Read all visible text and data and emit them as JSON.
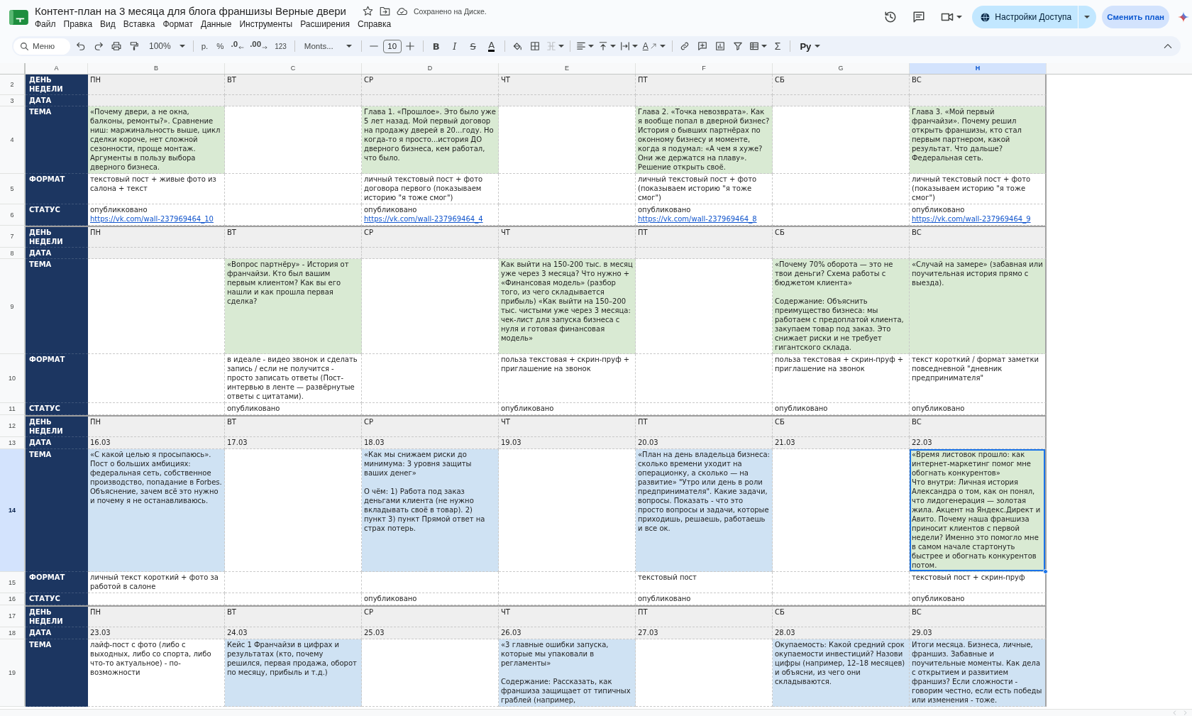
{
  "document": {
    "title": "Контент-план на 3 месяца для блога франшизы Верные двери",
    "save_status": "Сохранено на Диске."
  },
  "menu": [
    "Файл",
    "Правка",
    "Вид",
    "Вставка",
    "Формат",
    "Данные",
    "Инструменты",
    "Расширения",
    "Справка"
  ],
  "actions": {
    "share": "Настройки Доступа",
    "change_plan": "Сменить план"
  },
  "toolbar": {
    "search_placeholder": "Меню",
    "zoom": "100%",
    "currency": "р.",
    "percent": "%",
    "decrease_decimals": ".0",
    "increase_decimals": ".00",
    "number_format": "123",
    "font": "Monts...",
    "font_size": "10",
    "bold": "B",
    "italic": "I",
    "strikethrough": "S",
    "text_color": "A",
    "merge_disabled": true,
    "text_rotation": "A",
    "functions": "Σ",
    "input_tools": "Ру"
  },
  "columns": [
    {
      "label": "A",
      "selected": false
    },
    {
      "label": "B",
      "selected": false
    },
    {
      "label": "C",
      "selected": false
    },
    {
      "label": "D",
      "selected": false
    },
    {
      "label": "E",
      "selected": false
    },
    {
      "label": "F",
      "selected": false
    },
    {
      "label": "G",
      "selected": false
    },
    {
      "label": "H",
      "selected": true
    }
  ],
  "weeks": [
    {
      "rows": [
        {
          "number": "2",
          "selected": false,
          "kind": "day",
          "label": "ДЕНЬ НЕДЕЛИ",
          "cells": [
            {
              "text": "ПН"
            },
            {
              "text": "ВТ"
            },
            {
              "text": "СР"
            },
            {
              "text": "ЧТ"
            },
            {
              "text": "ПТ"
            },
            {
              "text": "СБ"
            },
            {
              "text": "ВС"
            }
          ]
        },
        {
          "number": "3",
          "selected": false,
          "kind": "date",
          "label": "ДАТА",
          "cells": [
            {},
            {},
            {},
            {},
            {},
            {},
            {}
          ]
        },
        {
          "number": "4",
          "selected": false,
          "kind": "topic",
          "label": "ТЕМА",
          "cells": [
            {
              "text": "«Почему двери, а не окна, балконы, ремонты?». Сравнение ниш: маржинальность выше, цикл сделки короче, нет сложной сезонности, проще монтаж. Аргументы в пользу выбора дверного бизнеса.",
              "color": "#d9ead3"
            },
            {},
            {
              "text": "Глава 1. «Прошлое». Это было уже 5 лет назад. Мой первый договор на продажу дверей в 20...году. Но когда-то я просто...история ДО дверного бизнеса, кем работал, что было.",
              "color": "#d9ead3"
            },
            {},
            {
              "text": "Глава 2. «Точка невозврата». Как я вообще попал в дверной бизнес? История о бывших партнёрах по оконному бизнесу и моменте, когда я подумал: «А чем я хуже? Они же держатся на плаву». Решение открыть своё.",
              "color": "#d9ead3"
            },
            {},
            {
              "text": "Глава 3. «Мой первый франчайзи». Почему решил открыть франшизы, кто стал первым партнером, какой результат. Что дальше? Федеральная сеть.",
              "color": "#d9ead3"
            }
          ]
        },
        {
          "number": "5",
          "selected": false,
          "kind": "format",
          "label": "ФОРМАТ",
          "cells": [
            {
              "text": "текстовый пост + живые фото из салона + текст"
            },
            {},
            {
              "text": "личный текстовый пост + фото договора первого (показываем историю \"я тоже смог\")"
            },
            {},
            {
              "text": "личный текстовый пост + фото (показываем историю \"я тоже смог\")"
            },
            {},
            {
              "text": "личный текстовый пост + фото (показываем историю \"я тоже смог\")"
            }
          ]
        },
        {
          "number": "6",
          "selected": false,
          "kind": "status",
          "label": "СТАТУС",
          "cells": [
            {
              "text": "опубликковано",
              "link": "https://vk.com/wall-237969464_10"
            },
            {},
            {
              "text": "опубликовано",
              "link": "https://vk.com/wall-237969464_4"
            },
            {},
            {
              "text": "опубликовано",
              "link": "https://vk.com/wall-237969464_8"
            },
            {},
            {
              "text": "опубликовано",
              "link": "https://vk.com/wall-237969464_9"
            }
          ]
        }
      ]
    },
    {
      "rows": [
        {
          "number": "7",
          "selected": false,
          "kind": "day",
          "label": "ДЕНЬ НЕДЕЛИ",
          "cells": [
            {
              "text": "ПН"
            },
            {
              "text": "ВТ"
            },
            {
              "text": "СР"
            },
            {
              "text": "ЧТ"
            },
            {
              "text": "ПТ"
            },
            {
              "text": "СБ"
            },
            {
              "text": "ВС"
            }
          ]
        },
        {
          "number": "8",
          "selected": false,
          "kind": "date",
          "label": "ДАТА",
          "cells": [
            {},
            {},
            {},
            {},
            {},
            {},
            {}
          ]
        },
        {
          "number": "9",
          "selected": false,
          "kind": "topic",
          "label": "ТЕМА",
          "cells": [
            {},
            {
              "text": "«Вопрос партнёру» - История от франчайзи. Кто был вашим первым клиентом? Как вы его нашли и как прошла первая сделка?",
              "color": "#d9ead3"
            },
            {},
            {
              "text": "Как выйти на 150-200 тыс. в месяц уже через 3 месяца? Что нужно + «Финансовая модель» (разбор того, из чего складывается прибыль) «Как выйти на 150–200 тыс. чистыми уже через 3 месяца: чек-лист для запуска бизнеса с нуля и готовая финансовая модель»",
              "color": "#d9ead3"
            },
            {},
            {
              "text": "«Почему 70% оборота — это не твои деньги? Схема работы с бюджетом клиента»\n\nСодержание: Объяснить преимущество бизнеса: мы работаем с предоплатой клиента, закупаем товар под заказ. Это снижает риски и не требует гигантского склада.",
              "color": "#d9ead3"
            },
            {
              "text": "«Случай на замере» (забавная или поучительная история прямо с выезда).",
              "color": "#d9ead3"
            }
          ]
        },
        {
          "number": "10",
          "selected": false,
          "kind": "format",
          "label": "ФОРМАТ",
          "cells": [
            {},
            {
              "text": "в идеале - видео звонок и сделать запись / если не получится - просто записать ответы (Пост-интервью в ленте — развёрнутые ответы с цитатами)."
            },
            {},
            {
              "text": "польза текстовая + скрин-пруф + приглашение на звонок"
            },
            {},
            {
              "text": "польза текстовая + скрин-пруф + приглашение на звонок"
            },
            {
              "text": "текст короткий / формат заметки повседневной \"дневник предпринимателя\""
            }
          ]
        },
        {
          "number": "11",
          "selected": false,
          "kind": "status",
          "label": "СТАТУС",
          "cells": [
            {},
            {
              "text": "опубликовано"
            },
            {},
            {
              "text": "опубликовано"
            },
            {},
            {
              "text": "опубликовано"
            },
            {
              "text": "опубликовано"
            }
          ]
        }
      ]
    },
    {
      "rows": [
        {
          "number": "12",
          "selected": false,
          "kind": "day",
          "label": "ДЕНЬ НЕДЕЛИ",
          "cells": [
            {
              "text": "ПН"
            },
            {
              "text": "ВТ"
            },
            {
              "text": "СР"
            },
            {
              "text": "ЧТ"
            },
            {
              "text": "ПТ"
            },
            {
              "text": "СБ"
            },
            {
              "text": "ВС"
            }
          ]
        },
        {
          "number": "13",
          "selected": false,
          "kind": "date",
          "label": "ДАТА",
          "cells": [
            {
              "text": "16.03"
            },
            {
              "text": "17.03"
            },
            {
              "text": "18.03"
            },
            {
              "text": "19.03"
            },
            {
              "text": "20.03"
            },
            {
              "text": "21.03"
            },
            {
              "text": "22.03"
            }
          ]
        },
        {
          "number": "14",
          "selected": true,
          "kind": "topic",
          "label": "ТЕМА",
          "cells": [
            {
              "text": "«С какой целью я просыпаюсь». Пост о больших амбициях: федеральная сеть, собственное производство, попадание в Forbes. Объяснение, зачем всё это нужно и почему я не останавливаюсь.",
              "color": "#cfe2f3"
            },
            {},
            {
              "text": "«Как мы снижаем риски до минимума: 3 уровня защиты ваших денег»\n\nО чём: 1) Работа под заказ деньгами клиента (не нужно вкладывать своё в товар). 2) пункт 3) пункт Прямой ответ на страх потерь.",
              "color": "#cfe2f3"
            },
            {},
            {
              "text": "«План на день владельца бизнеса: сколько времени уходит на операционку, а сколько — на развитие» \"Утро или день в роли предпринимателя\". Какие задачи, вопросы. Показать - что это просто вопросы и задачи, которые приходишь, решаешь, работаешь и все ок.",
              "color": "#cfe2f3"
            },
            {},
            {
              "text": "«Время листовок прошло: как интернет-маркетинг помог мне обогнать конкурентов»\nЧто внутри: Личная история Александра о том, как он понял, что лидогенерация — золотая жила. Акцент на Яндекс.Директ и Авито. Почему наша франшиза приносит клиентов с первой недели? Именно это помогло мне в самом начале стартонуть быстрее и обогнать конкурентов потом.",
              "color": "#d9ead3"
            }
          ]
        },
        {
          "number": "15",
          "selected": false,
          "kind": "format",
          "label": "ФОРМАТ",
          "cells": [
            {
              "text": "личный текст короткий + фото за работой в салоне"
            },
            {},
            {},
            {},
            {
              "text": "текстовый пост"
            },
            {},
            {
              "text": "текстовый пост + скрин-пруф"
            }
          ]
        },
        {
          "number": "16",
          "selected": false,
          "kind": "status",
          "label": "СТАТУС",
          "cells": [
            {},
            {},
            {
              "text": "опубликовано"
            },
            {},
            {
              "text": "опубликовано"
            },
            {},
            {
              "text": "опубликовано"
            }
          ]
        }
      ]
    },
    {
      "rows": [
        {
          "number": "17",
          "selected": false,
          "kind": "day",
          "label": "ДЕНЬ НЕДЕЛИ",
          "cells": [
            {
              "text": "ПН"
            },
            {
              "text": "ВТ"
            },
            {
              "text": "СР"
            },
            {
              "text": "ЧТ"
            },
            {
              "text": "ПТ"
            },
            {
              "text": "СБ"
            },
            {
              "text": "ВС"
            }
          ]
        },
        {
          "number": "18",
          "selected": false,
          "kind": "date",
          "label": "ДАТА",
          "cells": [
            {
              "text": "23.03"
            },
            {
              "text": "24.03"
            },
            {
              "text": "25.03"
            },
            {
              "text": "26.03"
            },
            {
              "text": "27.03"
            },
            {
              "text": "28.03"
            },
            {
              "text": "29.03"
            }
          ]
        },
        {
          "number": "19",
          "selected": false,
          "kind": "topic",
          "label": "ТЕМА",
          "cells": [
            {
              "text": "лайф-пост с фото (либо с выходных, либо со спорта, либо что-то актуальное) - по-возможности"
            },
            {
              "text": "Кейс 1 Франчайзи в цифрах и результатах (кто, почему решился, первая продажа, оборот по месяцу, прибыль и т.д.)",
              "color": "#cfe2f3"
            },
            {},
            {
              "text": "«3 главные ошибки запуска, которые мы упаковали в регламенты»\n\nСодержание: Рассказать, как франшиза защищает от типичных граблей (например,",
              "color": "#cfe2f3"
            },
            {},
            {
              "text": "Окупаемость: Какой средний срок окупаемости инвестиций? Назови цифры (например, 12–18 месяцев) и объясни, из чего они складываются.",
              "color": "#cfe2f3"
            },
            {
              "text": "Итоги месяца. Бизнеса, личные, франшиз. Забавные и поучительные моменты. Как дела с открытием и развитием франшиз? Если сложности - говорим честно, если есть победы или изменения - тоже.",
              "color": "#cfe2f3"
            }
          ]
        }
      ]
    }
  ]
}
